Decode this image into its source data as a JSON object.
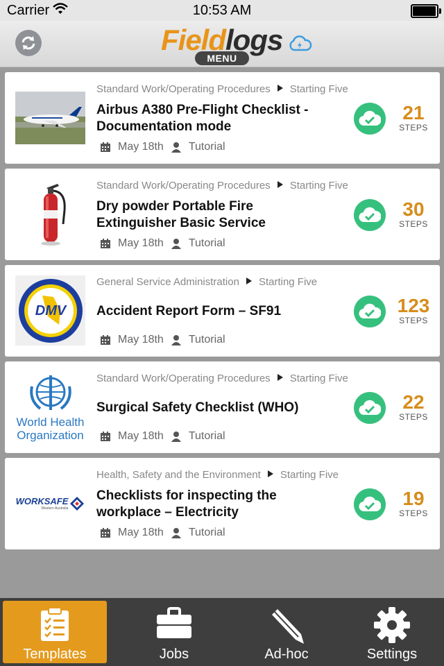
{
  "status_bar": {
    "carrier": "Carrier",
    "time": "10:53 AM"
  },
  "header": {
    "logo_part1": "Field",
    "logo_part2": "logs",
    "menu_label": "MENU"
  },
  "templates": [
    {
      "category": "Standard Work/Operating Procedures",
      "owner": "Starting Five",
      "title_line1": "Airbus A380 Pre-Flight Checklist -",
      "title_line2": "Documentation mode",
      "date": "May 18th",
      "author": "Tutorial",
      "steps": "21",
      "steps_label": "STEPS",
      "thumb_icon": "airplane-photo"
    },
    {
      "category": "Standard Work/Operating Procedures",
      "owner": "Starting Five",
      "title_line1": "Dry powder Portable Fire",
      "title_line2": "Extinguisher Basic Service",
      "date": "May 18th",
      "author": "Tutorial",
      "steps": "30",
      "steps_label": "STEPS",
      "thumb_icon": "fire-extinguisher-photo"
    },
    {
      "category": "General Service Administration",
      "owner": "Starting Five",
      "title_line1": "Accident Report Form – SF91",
      "title_line2": "",
      "date": "May 18th",
      "author": "Tutorial",
      "steps": "123",
      "steps_label": "STEPS",
      "thumb_icon": "dmv-seal-logo"
    },
    {
      "category": "Standard Work/Operating Procedures",
      "owner": "Starting Five",
      "title_line1": "Surgical Safety Checklist (WHO)",
      "title_line2": "",
      "date": "May 18th",
      "author": "Tutorial",
      "steps": "22",
      "steps_label": "STEPS",
      "thumb_icon": "who-logo"
    },
    {
      "category": "Health, Safety and the Environment",
      "owner": "Starting Five",
      "title_line1": "Checklists for inspecting the",
      "title_line2": "workplace – Electricity",
      "date": "May 18th",
      "author": "Tutorial",
      "steps": "19",
      "steps_label": "STEPS",
      "thumb_icon": "worksafe-logo"
    }
  ],
  "logos": {
    "dmv_text": "DMV",
    "who_line1": "World Health",
    "who_line2": "Organization",
    "worksafe_text": "WORKSAFE",
    "worksafe_sub": "Western Australia"
  },
  "tabs": [
    {
      "label": "Templates",
      "icon": "clipboard-icon",
      "active": true
    },
    {
      "label": "Jobs",
      "icon": "briefcase-icon",
      "active": false
    },
    {
      "label": "Ad-hoc",
      "icon": "pencil-icon",
      "active": false
    },
    {
      "label": "Settings",
      "icon": "gear-icon",
      "active": false
    }
  ],
  "colors": {
    "accent_orange": "#e49a1d",
    "steps_orange": "#d68d1c",
    "synced_green": "#36c07d",
    "tabbar": "#3e3e3e"
  }
}
